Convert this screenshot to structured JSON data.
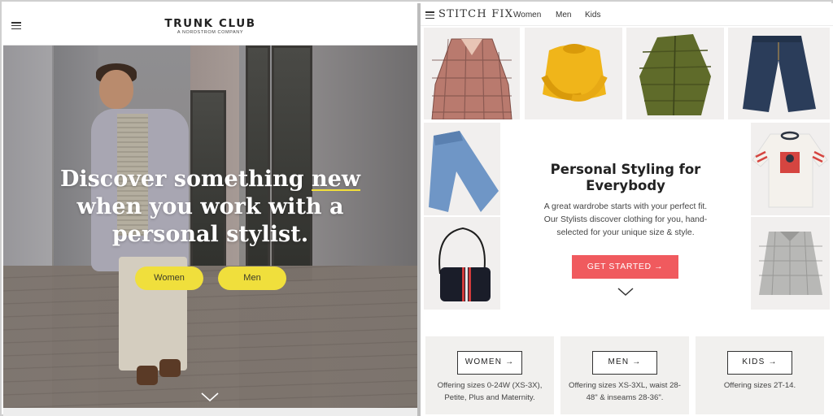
{
  "trunk_club": {
    "logo": "TRUNK CLUB",
    "logo_sub": "A NORDSTROM COMPANY",
    "headline_line1_pre": "Discover something ",
    "headline_line1_hl": "new",
    "headline_line2": "when you work with a",
    "headline_line3": "personal stylist.",
    "buttons": [
      "Women",
      "Men"
    ],
    "accent_color": "#f0df3c"
  },
  "stitch_fix": {
    "logo": "STITCH FIX",
    "nav": [
      "Women",
      "Men",
      "Kids"
    ],
    "title_line1": "Personal Styling for",
    "title_line2": "Everybody",
    "body_line1": "A great wardrobe starts with your perfect fit.",
    "body_line2": "Our Stylists discover clothing for you, hand-",
    "body_line3": "selected for your unique size & style.",
    "cta": "GET STARTED →",
    "cta_color": "#f05a5e",
    "categories": [
      {
        "label": "WOMEN →",
        "desc_line1": "Offering sizes 0-24W (XS-3X),",
        "desc_line2": "Petite, Plus and Maternity."
      },
      {
        "label": "MEN →",
        "desc_line1": "Offering sizes XS-3XL, waist 28-",
        "desc_line2": "48\" & inseams 28-36\"."
      },
      {
        "label": "KIDS →",
        "desc_line1": "Offering sizes 2T-14.",
        "desc_line2": ""
      }
    ],
    "products": [
      "plaid-coat",
      "yellow-sweater",
      "green-puffer-jacket",
      "dark-jeans",
      "light-jeans",
      "graphic-tee",
      "crossbody-bag",
      "plaid-shirt"
    ]
  }
}
